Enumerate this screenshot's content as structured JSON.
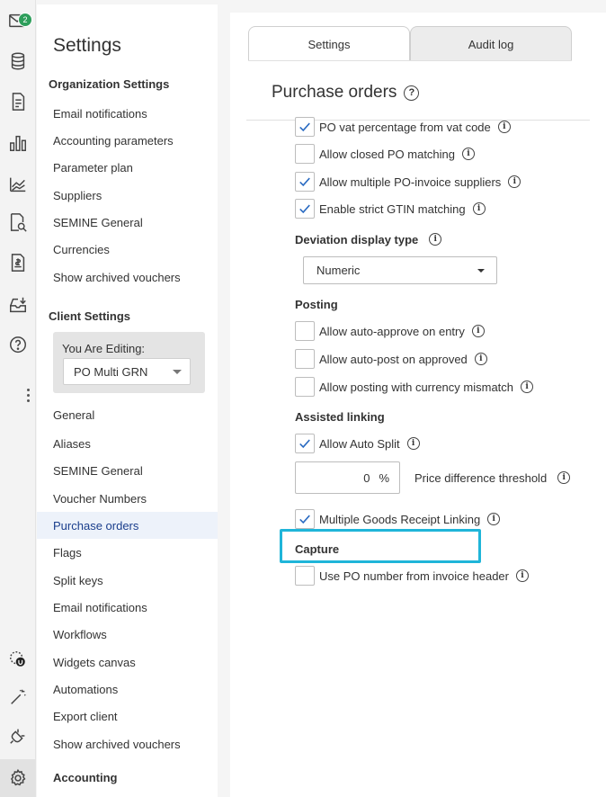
{
  "rail": {
    "mail_badge": "2",
    "icons": [
      "mail-icon",
      "database-icon",
      "invoice-icon",
      "bar-chart-icon",
      "trend-chart-icon",
      "search-document-icon",
      "money-document-icon",
      "inbox-download-icon",
      "help-icon",
      "more-icon",
      "user-avatar-icon",
      "magic-wand-icon",
      "plug-icon",
      "gear-icon"
    ]
  },
  "sidebar": {
    "title": "Settings",
    "org_heading": "Organization Settings",
    "org_items": [
      "Email notifications",
      "Accounting parameters",
      "Parameter plan",
      "Suppliers",
      "SEMINE General",
      "Currencies",
      "Show archived vouchers"
    ],
    "client_heading": "Client Settings",
    "editing_label": "You Are Editing:",
    "editing_value": "PO Multi GRN",
    "general_heading": "General",
    "general_items": [
      "Aliases",
      "SEMINE General",
      "Voucher Numbers",
      "Purchase orders",
      "Flags",
      "Split keys",
      "Email notifications",
      "Workflows",
      "Widgets canvas",
      "Automations",
      "Export client",
      "Show archived vouchers"
    ],
    "accounting_heading": "Accounting",
    "active_item": "Purchase orders"
  },
  "main": {
    "tabs": [
      {
        "label": "Settings"
      },
      {
        "label": "Audit log"
      }
    ],
    "page_title": "Purchase orders",
    "help_glyph": "?",
    "options_top": [
      {
        "label": "PO vat percentage from vat code",
        "checked": true
      },
      {
        "label": "Allow closed PO matching",
        "checked": false
      },
      {
        "label": "Allow multiple PO-invoice suppliers",
        "checked": true
      },
      {
        "label": "Enable strict GTIN matching",
        "checked": true
      }
    ],
    "deviation_heading": "Deviation display type",
    "deviation_value": "Numeric",
    "posting_heading": "Posting",
    "posting_options": [
      {
        "label": "Allow auto-approve on entry",
        "checked": false
      },
      {
        "label": "Allow auto-post on approved",
        "checked": false
      },
      {
        "label": "Allow posting with currency mismatch",
        "checked": false
      }
    ],
    "linking_heading": "Assisted linking",
    "auto_split": {
      "label": "Allow Auto Split",
      "checked": true
    },
    "price_diff_value": "0",
    "price_diff_unit": "%",
    "price_diff_label": "Price difference threshold",
    "multi_grn": {
      "label": "Multiple Goods Receipt Linking",
      "checked": true
    },
    "capture_heading": "Capture",
    "capture_option": {
      "label": "Use PO number from invoice header",
      "checked": false
    },
    "info_glyph": "i"
  },
  "colors": {
    "accent": "#1a3e8c",
    "highlight": "#1fb5d9",
    "badge": "#2e9e5b",
    "check": "#2a6bc2"
  }
}
